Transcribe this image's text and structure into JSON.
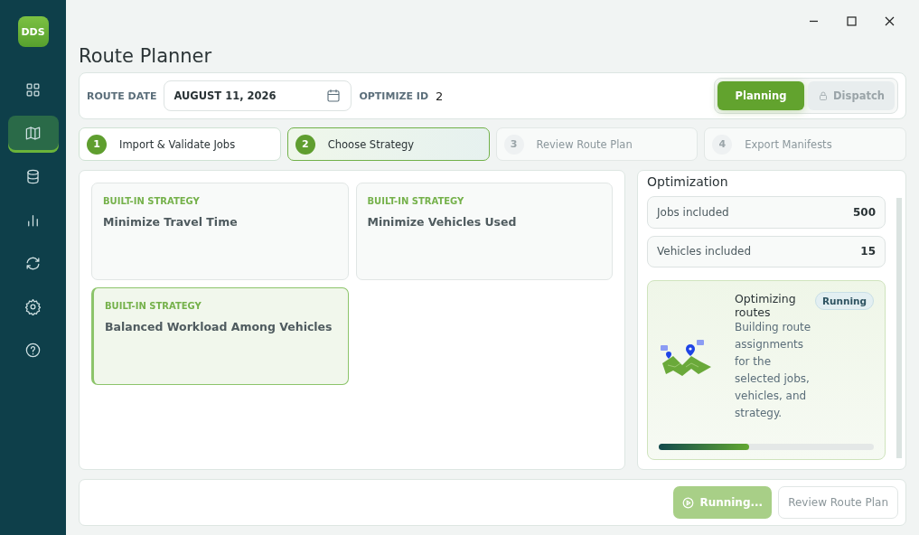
{
  "sidebar": {
    "logo": "DDS",
    "items": [
      {
        "selected": false
      },
      {
        "selected": true
      },
      {
        "selected": false
      },
      {
        "selected": false
      },
      {
        "selected": false
      },
      {
        "selected": false
      },
      {
        "selected": false
      }
    ]
  },
  "window": {
    "title": "Route Planner"
  },
  "toolbar": {
    "route_date_label": "ROUTE DATE",
    "route_date": "AUGUST 11, 2026",
    "optimize_id_label": "OPTIMIZE ID",
    "optimize_id": "2",
    "modes": [
      {
        "label": "Planning",
        "selected": true,
        "locked": false
      },
      {
        "label": "Dispatch",
        "selected": false,
        "locked": true
      }
    ]
  },
  "steps": [
    {
      "number": "1",
      "label": "Import & Validate Jobs",
      "selected": false,
      "disabled": false
    },
    {
      "number": "2",
      "label": "Choose Strategy",
      "selected": true,
      "disabled": false
    },
    {
      "number": "3",
      "label": "Review Route Plan",
      "selected": false,
      "disabled": true
    },
    {
      "number": "4",
      "label": "Export Manifests",
      "selected": false,
      "disabled": true
    }
  ],
  "strategies": [
    {
      "tag": "BUILT-IN STRATEGY",
      "name": "Minimize Travel Time",
      "selected": false
    },
    {
      "tag": "BUILT-IN STRATEGY",
      "name": "Minimize Vehicles Used",
      "selected": false
    },
    {
      "tag": "BUILT-IN STRATEGY",
      "name": "Balanced Workload Among Vehicles",
      "selected": true
    }
  ],
  "optimization": {
    "title": "Optimization",
    "stats": [
      {
        "label": "Jobs included",
        "value": "500"
      },
      {
        "label": "Vehicles included",
        "value": "15"
      }
    ],
    "status": {
      "title": "Optimizing routes",
      "badge": "Running",
      "description": "Building route assignments for the selected jobs, vehicles, and strategy.",
      "level": 0.42
    }
  },
  "footer": {
    "buttons": [
      {
        "label": "Running...",
        "kind": "primary",
        "disabled": true
      },
      {
        "label": "Review Route Plan",
        "kind": "secondary",
        "disabled": true
      }
    ]
  }
}
